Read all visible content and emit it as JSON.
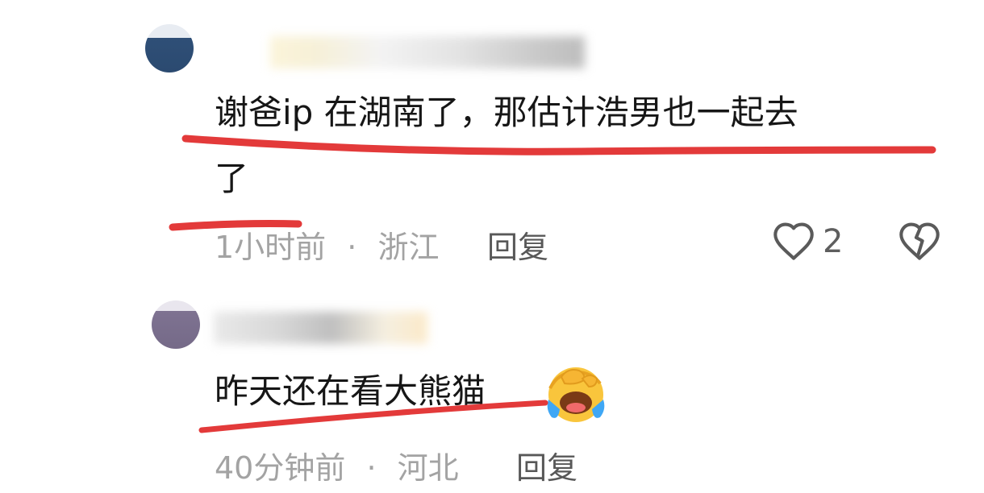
{
  "comments": [
    {
      "text_line1": "谢爸ip 在湖南了，那估计浩男也一起去",
      "text_line2": "了",
      "time": "1小时前",
      "separator": "·",
      "location": "浙江",
      "reply_label": "回复",
      "like_count": "2"
    },
    {
      "text": "昨天还在看大熊猫",
      "time": "40分钟前",
      "separator": "·",
      "location": "河北",
      "reply_label": "回复"
    }
  ],
  "icons": {
    "like": "heart-icon",
    "dislike": "broken-heart-icon",
    "emoji": "face-with-tears-of-joy-icon"
  },
  "colors": {
    "underline": "#e33a3a",
    "meta_text": "#a3a3a3",
    "reply_text": "#585858"
  }
}
